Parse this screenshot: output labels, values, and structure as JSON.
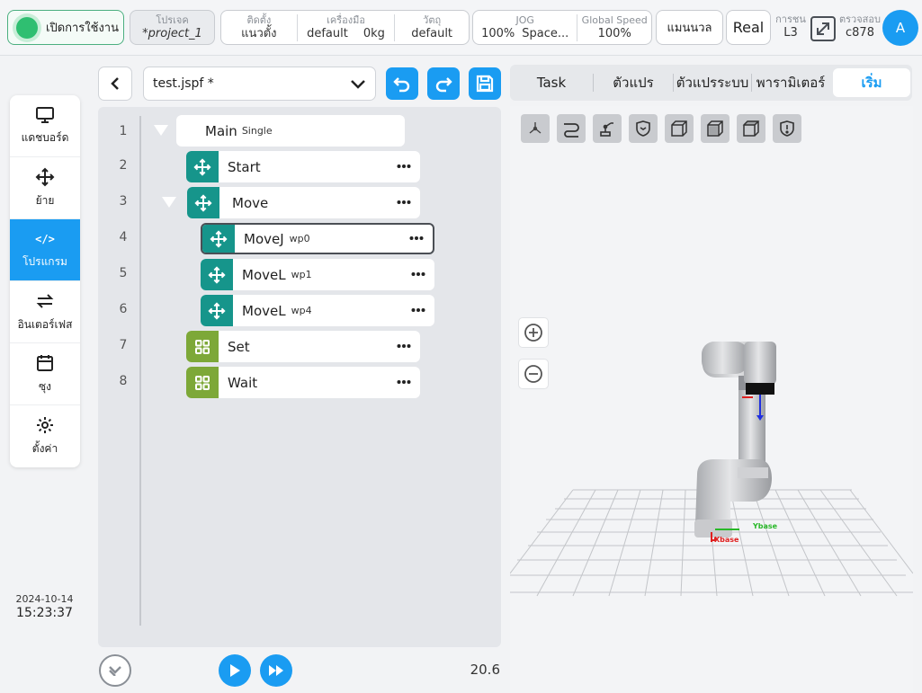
{
  "topbar": {
    "enable_label": "เปิดการใช้งาน",
    "project": {
      "label": "โปรเจค",
      "value": "*project_1"
    },
    "install": {
      "label": "ติดตั้ง",
      "value": "แนวตั้ง"
    },
    "tool": {
      "label": "เครื่องมือ",
      "value": "default",
      "weight": "0kg"
    },
    "payload": {
      "label": "วัตถุ",
      "value": "default"
    },
    "jog": {
      "label": "JOG",
      "value": "100%",
      "frame": "Space..."
    },
    "global_speed": {
      "label": "Global Speed",
      "value": "100%"
    },
    "mode": "แมนนวล",
    "env": "Real",
    "collision": {
      "label": "การชน",
      "value": "L3"
    },
    "check": {
      "label": "ตรวจสอบ",
      "value": "c878"
    },
    "avatar": "A"
  },
  "nav": {
    "items": [
      {
        "label": "แดชบอร์ด",
        "icon": "monitor-icon"
      },
      {
        "label": "ย้าย",
        "icon": "move-icon"
      },
      {
        "label": "โปรแกรม",
        "icon": "code-icon",
        "glyph": "</>",
        "active": true
      },
      {
        "label": "อินเตอร์เฟส",
        "icon": "swap-icon"
      },
      {
        "label": "ซุง",
        "icon": "calendar-icon"
      },
      {
        "label": "ตั้งค่า",
        "icon": "gear-icon"
      }
    ]
  },
  "clock": {
    "date": "2024-10-14",
    "time": "15:23:37"
  },
  "program": {
    "file": "test.jspf *",
    "lines": [
      {
        "num": "1",
        "name": "Main",
        "sub": "Single"
      },
      {
        "num": "2",
        "name": "Start",
        "sub": ""
      },
      {
        "num": "3",
        "name": "Move",
        "sub": ""
      },
      {
        "num": "4",
        "name": "MoveJ",
        "sub": "wp0"
      },
      {
        "num": "5",
        "name": "MoveL",
        "sub": "wp1"
      },
      {
        "num": "6",
        "name": "MoveL",
        "sub": "wp4"
      },
      {
        "num": "7",
        "name": "Set",
        "sub": ""
      },
      {
        "num": "8",
        "name": "Wait",
        "sub": ""
      }
    ],
    "speed": "20.6"
  },
  "tabs": [
    {
      "label": "Task"
    },
    {
      "label": "ตัวแปร"
    },
    {
      "label": "ตัวแปรระบบ"
    },
    {
      "label": "พารามิเตอร์"
    },
    {
      "label": "เริ่ม",
      "active": true
    }
  ],
  "viewport": {
    "axis_x": "Xbase",
    "axis_y": "Ybase"
  },
  "colors": {
    "accent": "#1a9cf2",
    "motion_block": "#16958b",
    "logic_block": "#7da838",
    "enable_green": "#2fbf71"
  }
}
